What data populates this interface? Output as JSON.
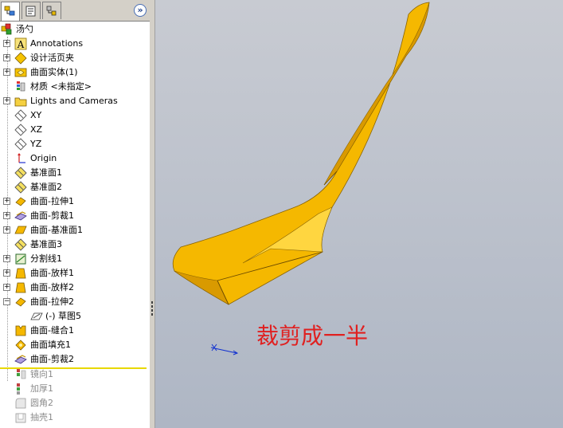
{
  "tabs": [
    {
      "name": "feature-manager",
      "icon": "feature-tree-icon"
    },
    {
      "name": "property-manager",
      "icon": "property-icon"
    },
    {
      "name": "configuration-manager",
      "icon": "configuration-icon"
    }
  ],
  "expand_label": "»",
  "tree": {
    "root": {
      "label": "汤勺",
      "icon": "part-icon"
    },
    "items": [
      {
        "label": "Annotations",
        "icon": "annotations-icon",
        "expandable": true
      },
      {
        "label": "设计活页夹",
        "icon": "design-binder-icon",
        "expandable": true
      },
      {
        "label": "曲面实体(1)",
        "icon": "surface-bodies-icon",
        "expandable": true
      },
      {
        "label": "材质 <未指定>",
        "icon": "material-icon",
        "expandable": false
      },
      {
        "label": "Lights and Cameras",
        "icon": "lights-cameras-icon",
        "expandable": true
      },
      {
        "label": "XY",
        "icon": "plane-icon",
        "expandable": false
      },
      {
        "label": "XZ",
        "icon": "plane-icon",
        "expandable": false
      },
      {
        "label": "YZ",
        "icon": "plane-icon",
        "expandable": false
      },
      {
        "label": "Origin",
        "icon": "origin-icon",
        "expandable": false
      },
      {
        "label": "基准面1",
        "icon": "ref-plane-icon",
        "expandable": false
      },
      {
        "label": "基准面2",
        "icon": "ref-plane-icon",
        "expandable": false
      },
      {
        "label": "曲面-拉伸1",
        "icon": "surface-extrude-icon",
        "expandable": true
      },
      {
        "label": "曲面-剪裁1",
        "icon": "surface-trim-icon",
        "expandable": true
      },
      {
        "label": "曲面-基准面1",
        "icon": "planar-surface-icon",
        "expandable": true
      },
      {
        "label": "基准面3",
        "icon": "ref-plane-icon",
        "expandable": false
      },
      {
        "label": "分割线1",
        "icon": "split-line-icon",
        "expandable": true
      },
      {
        "label": "曲面-放样1",
        "icon": "surface-loft-icon",
        "expandable": true
      },
      {
        "label": "曲面-放样2",
        "icon": "surface-loft-icon",
        "expandable": true
      },
      {
        "label": "曲面-拉伸2",
        "icon": "surface-extrude-icon",
        "expandable": true,
        "expanded": true
      },
      {
        "label": "(-) 草图5",
        "icon": "sketch-icon",
        "expandable": false,
        "child": true
      },
      {
        "label": "曲面-缝合1",
        "icon": "surface-knit-icon",
        "expandable": false
      },
      {
        "label": "曲面填充1",
        "icon": "surface-fill-icon",
        "expandable": false
      },
      {
        "label": "曲面-剪裁2",
        "icon": "surface-trim-icon",
        "expandable": false
      }
    ],
    "suppressed_items": [
      {
        "label": "镜向1",
        "icon": "mirror-icon"
      },
      {
        "label": "加厚1",
        "icon": "thicken-icon"
      },
      {
        "label": "圆角2",
        "icon": "fillet-icon"
      },
      {
        "label": "抽壳1",
        "icon": "shell-icon"
      }
    ]
  },
  "viewport": {
    "annotation_text": "裁剪成一半",
    "annotation_color": "#e02020",
    "model_color": "#f5b800",
    "model_shadow_color": "#d99a00",
    "model_highlight_color": "#ffd640",
    "triad_color": "#1030d0"
  }
}
